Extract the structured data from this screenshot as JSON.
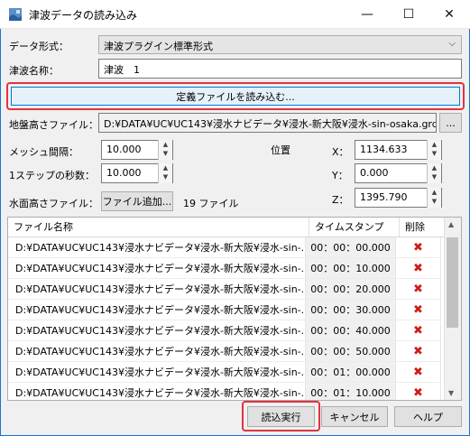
{
  "window": {
    "title": "津波データの読み込み",
    "minimize": "—",
    "maximize": "☐",
    "close": "✕"
  },
  "form": {
    "data_format_label": "データ形式：",
    "data_format_value": "津波プラグイン標準形式",
    "tsunami_name_label": "津波名称：",
    "tsunami_name_value": "津波　1",
    "load_def_button": "定義ファイルを読み込む...",
    "ground_file_label": "地盤高さファイル：",
    "ground_file_value": "D:¥DATA¥UC¥UC143¥浸水ナビデータ¥浸水-新大阪¥浸水-sin-osaka.grd",
    "browse_button": "...",
    "mesh_label": "メッシュ間隔：",
    "mesh_value": "10.000",
    "step_label": "1ステップの秒数：",
    "step_value": "10.000",
    "pos_label": "位置",
    "x_label": "X：",
    "x_value": "1134.633",
    "y_label": "Y：",
    "y_value": "0.000",
    "z_label": "Z：",
    "z_value": "1395.790",
    "water_file_label": "水面高さファイル：",
    "add_file_button": "ファイル追加...",
    "file_count": "19 ファイル"
  },
  "grid": {
    "headers": {
      "name": "ファイル名称",
      "timestamp": "タイムスタンプ",
      "delete": "削除"
    },
    "rows": [
      {
        "name": "D:¥DATA¥UC¥UC143¥浸水ナビデータ¥浸水-新大阪¥浸水-sin-...",
        "time": "00：00：00.000",
        "del": "✖"
      },
      {
        "name": "D:¥DATA¥UC¥UC143¥浸水ナビデータ¥浸水-新大阪¥浸水-sin-...",
        "time": "00：00：10.000",
        "del": "✖"
      },
      {
        "name": "D:¥DATA¥UC¥UC143¥浸水ナビデータ¥浸水-新大阪¥浸水-sin-...",
        "time": "00：00：20.000",
        "del": "✖"
      },
      {
        "name": "D:¥DATA¥UC¥UC143¥浸水ナビデータ¥浸水-新大阪¥浸水-sin-...",
        "time": "00：00：30.000",
        "del": "✖"
      },
      {
        "name": "D:¥DATA¥UC¥UC143¥浸水ナビデータ¥浸水-新大阪¥浸水-sin-...",
        "time": "00：00：40.000",
        "del": "✖"
      },
      {
        "name": "D:¥DATA¥UC¥UC143¥浸水ナビデータ¥浸水-新大阪¥浸水-sin-...",
        "time": "00：00：50.000",
        "del": "✖"
      },
      {
        "name": "D:¥DATA¥UC¥UC143¥浸水ナビデータ¥浸水-新大阪¥浸水-sin-...",
        "time": "00：01：00.000",
        "del": "✖"
      },
      {
        "name": "D:¥DATA¥UC¥UC143¥浸水ナビデータ¥浸水-新大阪¥浸水-sin-...",
        "time": "00：01：10.000",
        "del": "✖"
      }
    ]
  },
  "footer": {
    "execute_button": "読込実行",
    "cancel_button": "キャンセル",
    "help_button": "ヘルプ"
  },
  "colors": {
    "highlight": "#e0343f",
    "delete_icon": "#cc1d1d",
    "window_border": "#1a73d0"
  }
}
